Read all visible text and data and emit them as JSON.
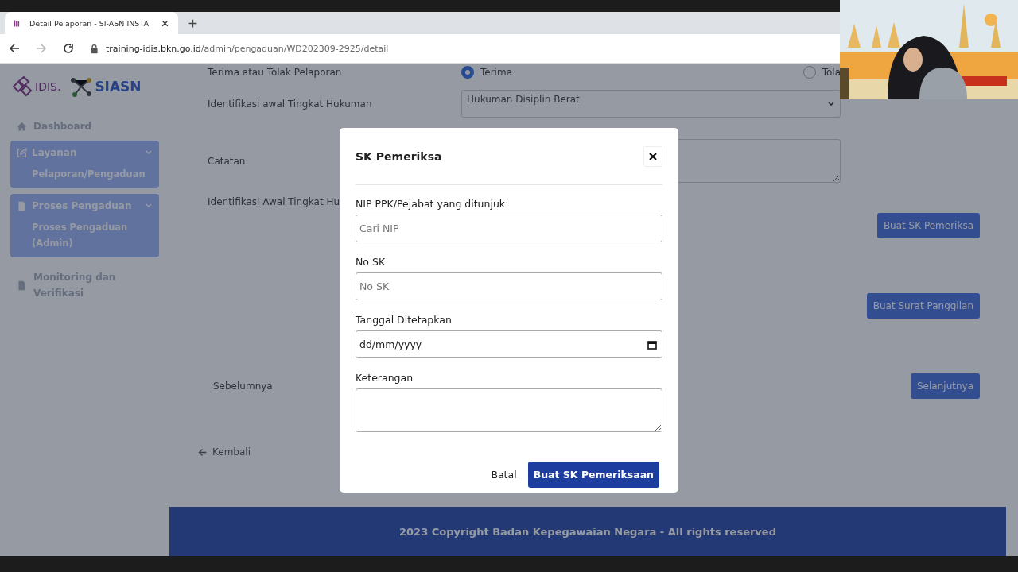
{
  "browser": {
    "tab_title": "Detail Pelaporan - SI-ASN INSTA",
    "url_host": "training-idis.bkn.go.id",
    "url_path": "/admin/pengaduan/WD202309-2925/detail"
  },
  "sidebar": {
    "logos": [
      "IDIS.",
      "SIASN"
    ],
    "items": [
      {
        "label": "Dashboard",
        "kind": "link"
      },
      {
        "label": "Layanan",
        "kind": "group",
        "children": [
          {
            "label": "Pelaporan/Pengaduan"
          }
        ]
      },
      {
        "label": "Proses Pengaduan",
        "kind": "group",
        "children": [
          {
            "label": "Proses Pengaduan (Admin)"
          }
        ]
      },
      {
        "label": "Monitoring dan Verifikasi",
        "kind": "link"
      }
    ]
  },
  "form": {
    "rows": [
      {
        "label": "Terima atau Tolak Pelaporan",
        "kind": "radio",
        "options": [
          {
            "label": "Terima",
            "selected": true
          },
          {
            "label": "Tola",
            "selected": false
          }
        ]
      },
      {
        "label": "Identifikasi awal Tingkat Hukuman",
        "kind": "select",
        "value": "Hukuman Disiplin Berat"
      },
      {
        "label": "Catatan",
        "kind": "textarea"
      },
      {
        "label": "Identifikasi Awal Tingkat Hu",
        "kind": "label"
      }
    ],
    "actions": [
      "Buat SK Pemeriksa",
      "Buat Surat Panggilan"
    ],
    "previous": "Sebelumnya",
    "next": "Selanjutnya",
    "back": "Kembali"
  },
  "footer": "2023 Copyright Badan Kepegawaian Negara - All rights reserved",
  "modal": {
    "title": "SK Pemeriksa",
    "fields": [
      {
        "label": "NIP PPK/Pejabat yang ditunjuk",
        "kind": "text",
        "placeholder": "Cari NIP"
      },
      {
        "label": "No SK",
        "kind": "text",
        "placeholder": "No SK"
      },
      {
        "label": "Tanggal Ditetapkan",
        "kind": "date",
        "placeholder": "dd/mm/yyyy"
      },
      {
        "label": "Keterangan",
        "kind": "textarea"
      }
    ],
    "cancel": "Batal",
    "submit": "Buat SK Pemeriksaan"
  }
}
